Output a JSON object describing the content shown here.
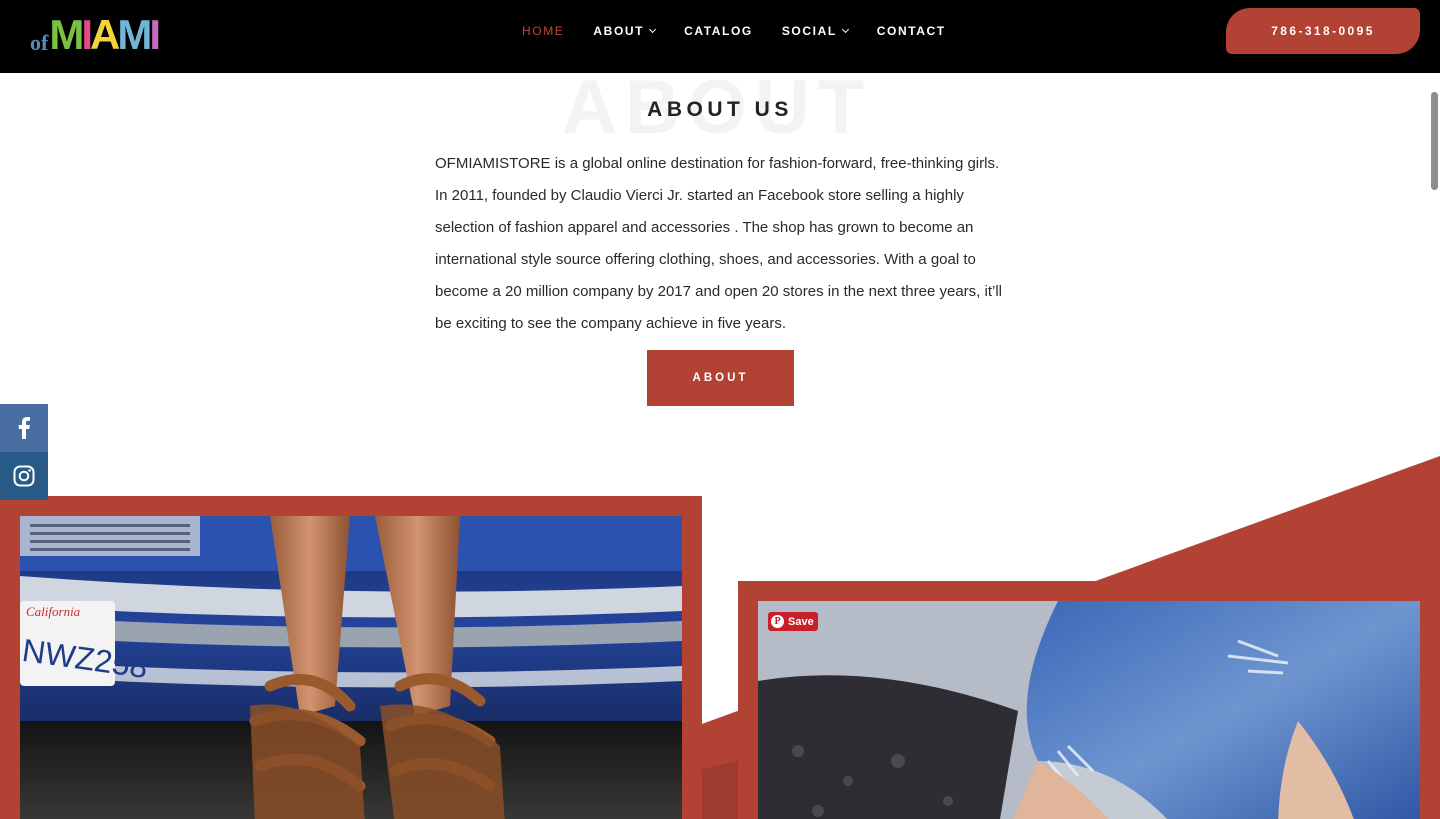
{
  "header": {
    "logo_prefix": "of",
    "logo_letters": [
      {
        "ch": "M",
        "color": "#79c043"
      },
      {
        "ch": "I",
        "color": "#e24a8a"
      },
      {
        "ch": "A",
        "color": "#f2d43b"
      },
      {
        "ch": "M",
        "color": "#6fb6d9"
      },
      {
        "ch": "I",
        "color": "#c86ac0"
      }
    ],
    "nav": [
      {
        "label": "HOME",
        "active": true,
        "dropdown": false
      },
      {
        "label": "ABOUT",
        "active": false,
        "dropdown": true
      },
      {
        "label": "CATALOG",
        "active": false,
        "dropdown": false
      },
      {
        "label": "SOCIAL",
        "active": false,
        "dropdown": true
      },
      {
        "label": "CONTACT",
        "active": false,
        "dropdown": false
      }
    ],
    "phone": "786-318-0095"
  },
  "about": {
    "background_word": "ABOUT",
    "title": "ABOUT US",
    "body": "OFMIAMISTORE is a global online destination for fashion-forward, free-thinking girls. In 2011, founded by Claudio Vierci Jr. started an Facebook store selling a highly selection of fashion apparel and accessories . The shop has grown to become an international style source offering clothing, shoes, and accessories. With a goal to become a 20 million company by 2017 and open 20 stores in the next three years, it’ll be exciting to see the company achieve in five years.",
    "button_label": "ABOUT"
  },
  "social": [
    {
      "icon": "facebook-icon"
    },
    {
      "icon": "instagram-icon"
    }
  ],
  "gallery": {
    "photo1_plate": "NWZ258",
    "pin_save_label": "Save"
  },
  "colors": {
    "accent": "#b24234",
    "header_bg": "#000000",
    "active_nav": "#c0473a"
  }
}
